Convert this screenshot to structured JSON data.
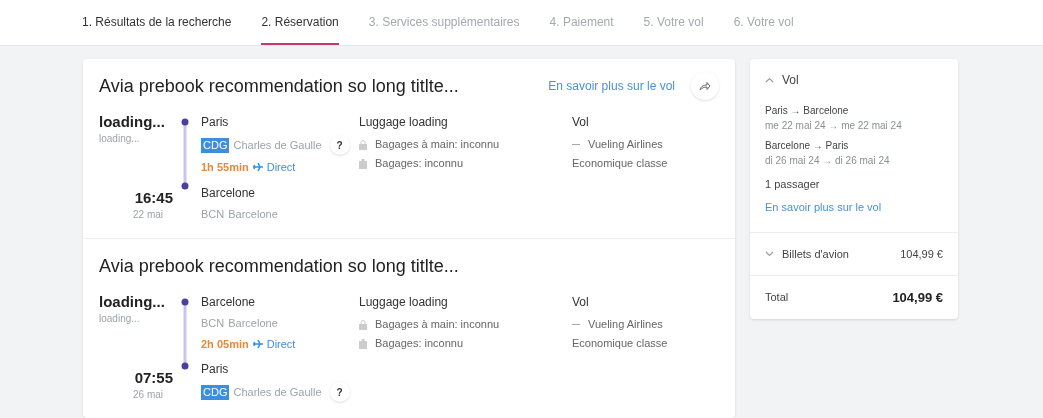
{
  "steps": [
    {
      "label": "1. Résultats de la recherche",
      "selected": false,
      "done": true
    },
    {
      "label": "2. Réservation",
      "selected": true,
      "done": true
    },
    {
      "label": "3. Services supplémentaires",
      "selected": false,
      "done": false
    },
    {
      "label": "4. Paiement",
      "selected": false,
      "done": false
    },
    {
      "label": "5. Votre vol",
      "selected": false,
      "done": false
    },
    {
      "label": "6. Votre vol",
      "selected": false,
      "done": false
    }
  ],
  "segments": [
    {
      "title": "Avia prebook recommendation so long titlte...",
      "link": "En savoir plus sur le vol",
      "share": true,
      "departure": {
        "time": "loading...",
        "date": "loading...",
        "city": "Paris",
        "airport": {
          "code": "CDG",
          "name": "Charles de Gaulle",
          "highlighted": true,
          "help": "?"
        }
      },
      "duration": "1h 55min",
      "direct": "Direct",
      "arrival": {
        "time": "16:45",
        "date": "22 mai",
        "city": "Barcelone",
        "airport": {
          "code": "BCN",
          "name": "Barcelone",
          "highlighted": false
        }
      },
      "luggage": {
        "title": "Luggage loading",
        "items": [
          {
            "kind": "cabin",
            "label": "Bagages à main: inconnu"
          },
          {
            "kind": "hold",
            "label": "Bagages: inconnu"
          }
        ]
      },
      "flight": {
        "title": "Vol",
        "airline": "Vueling Airlines",
        "class": "Economique classe"
      }
    },
    {
      "title": "Avia prebook recommendation so long titlte...",
      "share": false,
      "departure": {
        "time": "loading...",
        "date": "loading...",
        "city": "Barcelone",
        "airport": {
          "code": "BCN",
          "name": "Barcelone",
          "highlighted": false
        }
      },
      "duration": "2h 05min",
      "direct": "Direct",
      "arrival": {
        "time": "07:55",
        "date": "26 mai",
        "city": "Paris",
        "airport": {
          "code": "CDG",
          "name": "Charles de Gaulle",
          "highlighted": true,
          "help": "?"
        }
      },
      "luggage": {
        "title": "Luggage loading",
        "items": [
          {
            "kind": "cabin",
            "label": "Bagages à main: inconnu"
          },
          {
            "kind": "hold",
            "label": "Bagages: inconnu"
          }
        ]
      },
      "flight": {
        "title": "Vol",
        "airline": "Vueling Airlines",
        "class": "Economique classe"
      }
    }
  ],
  "summary": {
    "flight": {
      "title": "Vol",
      "expanded": true,
      "routes": [
        {
          "route": "Paris → Barcelone",
          "dates": "me 22 mai 24 → me 22 mai 24"
        },
        {
          "route": "Barcelone → Paris",
          "dates": "di 26 mai 24 → di 26 mai 24"
        }
      ],
      "passengers": "1 passager",
      "link": "En savoir plus sur le vol"
    },
    "tickets": {
      "title": "Billets d'avion",
      "expanded": false,
      "price": "104,99 €"
    },
    "total": {
      "label": "Total",
      "price": "104,99 €"
    }
  }
}
